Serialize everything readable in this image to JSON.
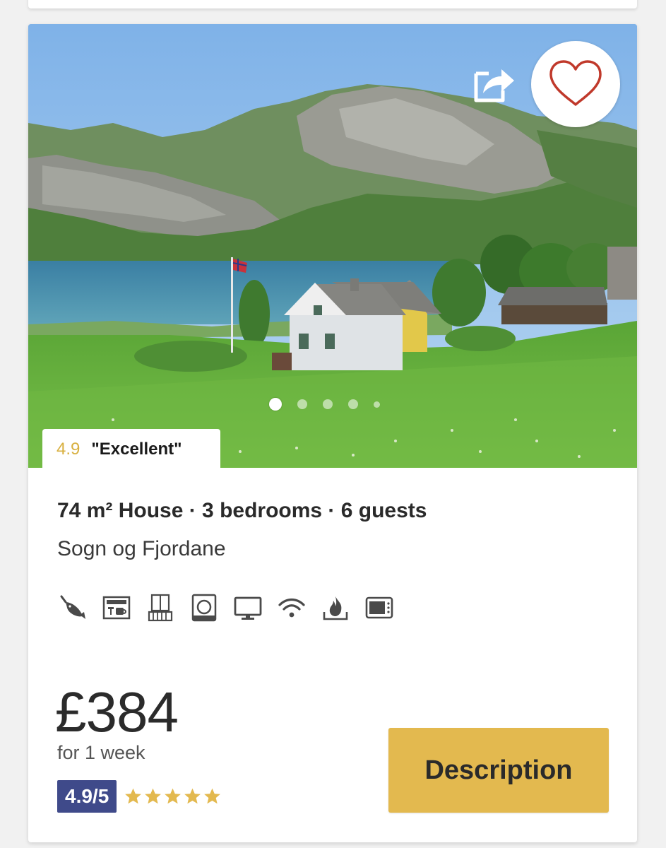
{
  "listing": {
    "rating_badge": {
      "score": "4.9",
      "verdict": "\"Excellent\""
    },
    "title": "74 m² House · 3 bedrooms · 6 guests",
    "location": "Sogn og Fjordane",
    "amenities": [
      "fishing-icon",
      "kitchen-icon",
      "balcony-icon",
      "washing-machine-icon",
      "tv-icon",
      "wifi-icon",
      "fireplace-icon",
      "microwave-icon"
    ],
    "price": "£384",
    "period": "for 1 week",
    "review_score": "4.9/5",
    "stars": 5,
    "description_button": "Description",
    "photo_carousel": {
      "total_indicators": 5,
      "active_index": 0
    },
    "colors": {
      "accent_gold": "#e3b94f",
      "rating_gold": "#d8b040",
      "review_badge_blue": "#3f4a8a",
      "heart_red": "#c0392b"
    }
  }
}
